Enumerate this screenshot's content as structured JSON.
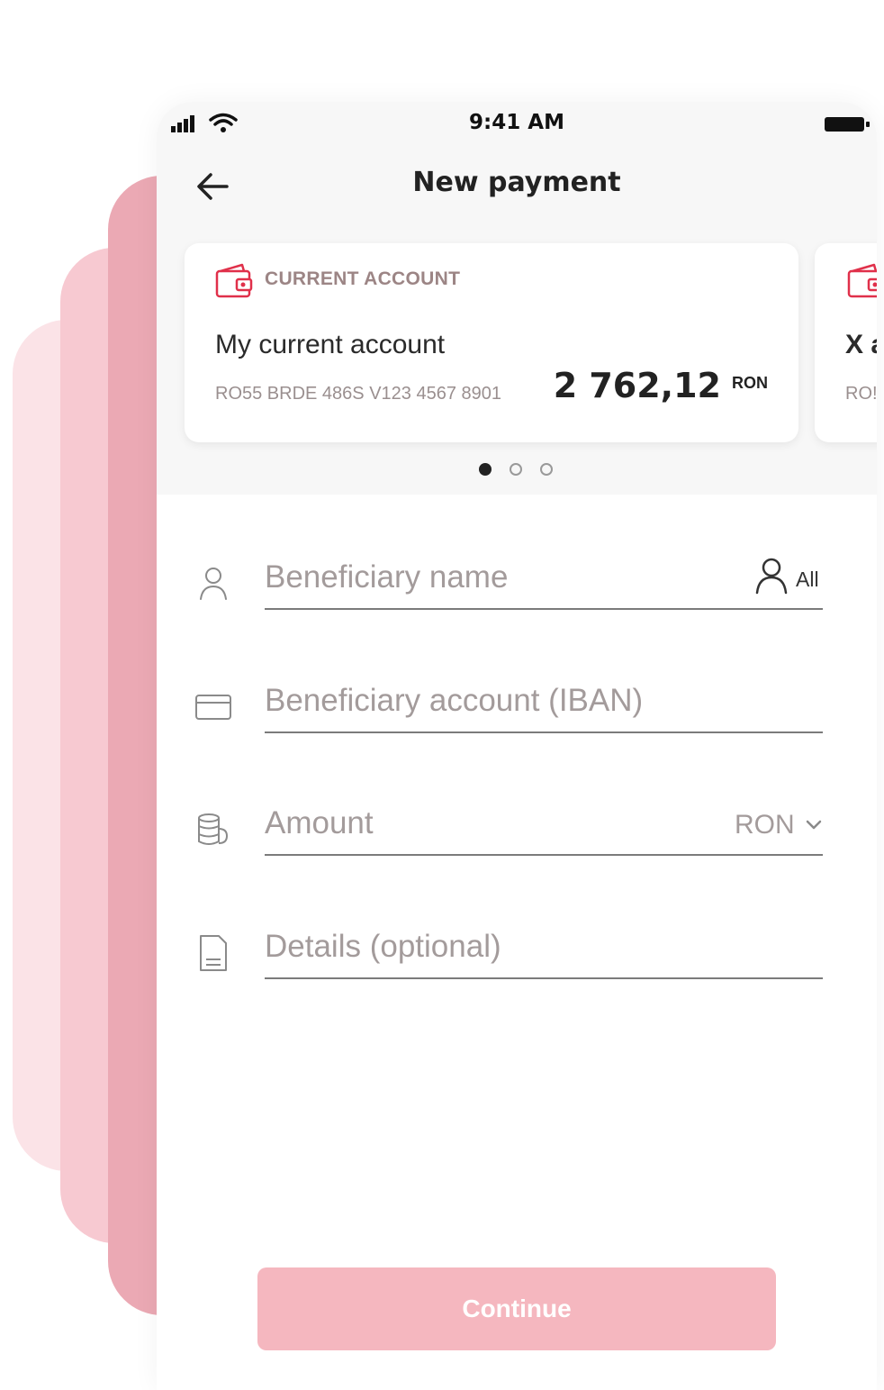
{
  "status_bar": {
    "time": "9:41 AM"
  },
  "header": {
    "title": "New payment"
  },
  "accounts": [
    {
      "type": "CURRENT ACCOUNT",
      "name": "My current account",
      "iban": "RO55 BRDE 486S V123 4567 8901",
      "balance": "2 762,12",
      "currency": "RON"
    },
    {
      "type": "",
      "name": "X a",
      "iban": "RO!",
      "balance": "",
      "currency": ""
    }
  ],
  "carousel": {
    "page_count": 3,
    "active_index": 0
  },
  "form": {
    "beneficiary_name": {
      "placeholder": "Beneficiary name",
      "value": "",
      "contacts_label": "All"
    },
    "beneficiary_account": {
      "placeholder": "Beneficiary account (IBAN)",
      "value": ""
    },
    "amount": {
      "placeholder": "Amount",
      "value": "",
      "currency": "RON"
    },
    "details": {
      "placeholder": "Details (optional)",
      "value": ""
    }
  },
  "actions": {
    "continue_label": "Continue"
  },
  "colors": {
    "accent": "#e0304a",
    "button_disabled": "#f5b7bf",
    "layer_dark": "#eba9b4",
    "layer_mid": "#f7c9d1",
    "layer_light": "#fbe3e7"
  }
}
